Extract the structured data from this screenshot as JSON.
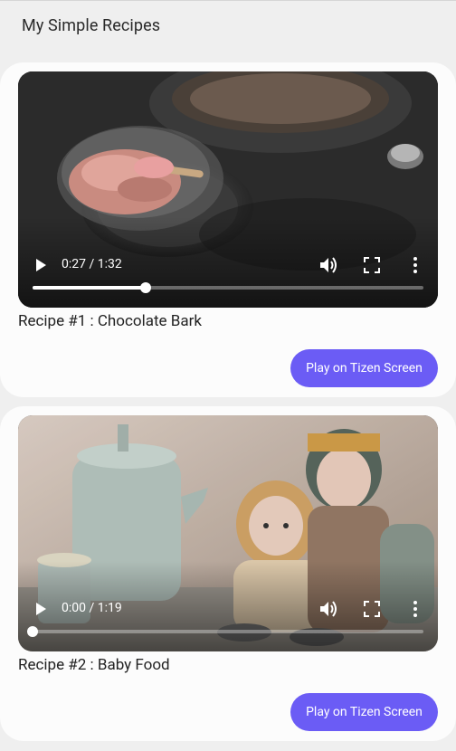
{
  "app": {
    "title": "My Simple Recipes"
  },
  "recipes": [
    {
      "title": "Recipe #1 : Chocolate Bark",
      "video": {
        "current_time": "0:27",
        "duration": "1:32",
        "time_display": "0:27 / 1:32",
        "progress": 0.29
      },
      "cast_button_label": "Play on Tizen Screen"
    },
    {
      "title": "Recipe #2 : Baby Food",
      "video": {
        "current_time": "0:00",
        "duration": "1:19",
        "time_display": "0:00 / 1:19",
        "progress": 0.0
      },
      "cast_button_label": "Play on Tizen Screen"
    }
  ],
  "icons": {
    "play": "play-icon",
    "volume": "volume-icon",
    "fullscreen": "fullscreen-icon",
    "more": "more-vert-icon"
  },
  "colors": {
    "accent": "#6b5cf5",
    "card_bg": "#fcfcfc",
    "page_bg": "#efefef"
  }
}
